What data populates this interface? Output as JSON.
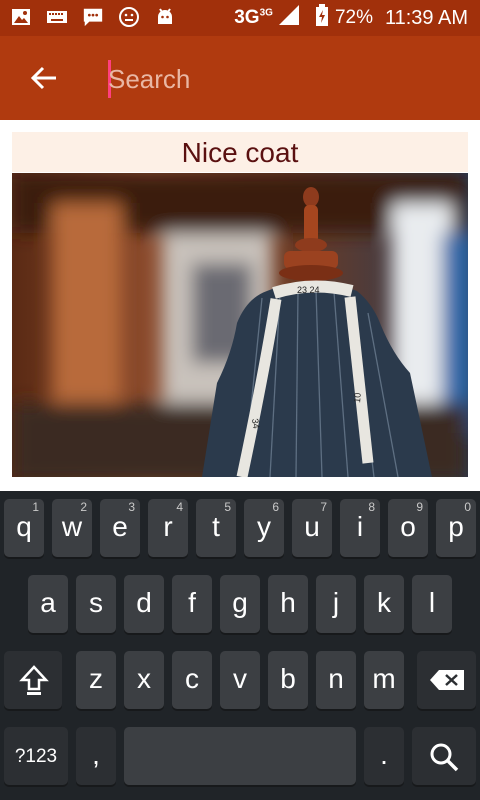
{
  "status_bar": {
    "network": "3G",
    "network_small": "3G",
    "battery": "72%",
    "time": "11:39 AM",
    "icons": [
      "image-icon",
      "keyboard-icon",
      "message-icon",
      "emoji-icon",
      "android-icon"
    ]
  },
  "app_bar": {
    "search_placeholder": "Search",
    "search_value": ""
  },
  "card": {
    "title": "Nice coat"
  },
  "keyboard": {
    "row1": [
      {
        "label": "q",
        "num": "1"
      },
      {
        "label": "w",
        "num": "2"
      },
      {
        "label": "e",
        "num": "3"
      },
      {
        "label": "r",
        "num": "4"
      },
      {
        "label": "t",
        "num": "5"
      },
      {
        "label": "y",
        "num": "6"
      },
      {
        "label": "u",
        "num": "7"
      },
      {
        "label": "i",
        "num": "8"
      },
      {
        "label": "o",
        "num": "9"
      },
      {
        "label": "p",
        "num": "0"
      }
    ],
    "row2": [
      "a",
      "s",
      "d",
      "f",
      "g",
      "h",
      "j",
      "k",
      "l"
    ],
    "row3": [
      "z",
      "x",
      "c",
      "v",
      "b",
      "n",
      "m"
    ],
    "symbols_label": "?123",
    "comma_label": ",",
    "period_label": "."
  },
  "colors": {
    "status_bar": "#a1300b",
    "app_bar": "#b03a0f",
    "title_band": "#fdf0e6",
    "title_text": "#5a1010"
  }
}
